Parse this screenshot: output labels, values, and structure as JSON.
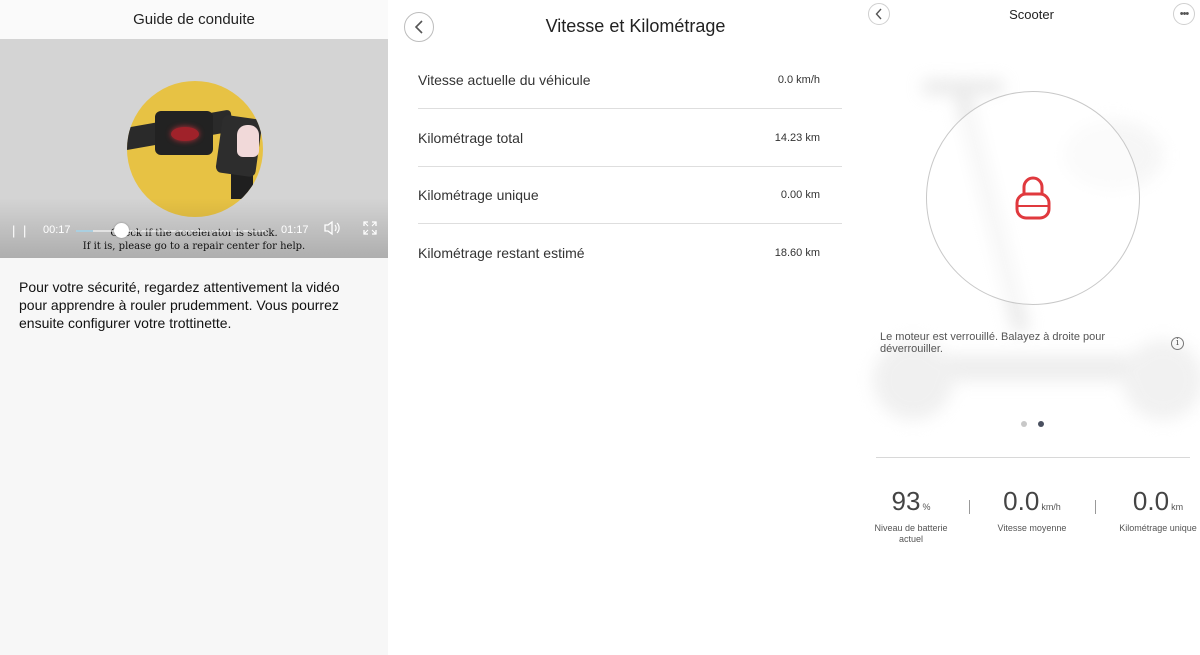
{
  "panel1": {
    "title": "Guide de conduite",
    "video": {
      "current_time": "00:17",
      "duration": "01:17",
      "progress": 0.26,
      "subtitle_line1": "Check if the accelerator is stuck.",
      "subtitle_line2": "If it is, please go to a repair center for help.",
      "play_pause_glyph": "| |"
    },
    "description": "Pour votre sécurité, regardez attentivement la vidéo pour apprendre à rouler prudemment. Vous pourrez ensuite configurer votre trottinette."
  },
  "panel2": {
    "title": "Vitesse et Kilométrage",
    "rows": [
      {
        "label": "Vitesse actuelle du véhicule",
        "value": "0.0 km/h"
      },
      {
        "label": "Kilométrage total",
        "value": "14.23 km"
      },
      {
        "label": "Kilométrage unique",
        "value": "0.00 km"
      },
      {
        "label": "Kilométrage restant estimé",
        "value": "18.60 km"
      }
    ]
  },
  "panel3": {
    "title": "Scooter",
    "lock_message": "Le moteur est verrouillé. Balayez à droite pour déverrouiller.",
    "lock_color": "#e0393e",
    "pager": {
      "count": 2,
      "active_index": 1
    },
    "stats": [
      {
        "value": "93",
        "unit": "%",
        "label": "Niveau de batterie actuel"
      },
      {
        "value": "0.0",
        "unit": "km/h",
        "label": "Vitesse moyenne"
      },
      {
        "value": "0.0",
        "unit": "km",
        "label": "Kilométrage unique"
      }
    ]
  }
}
